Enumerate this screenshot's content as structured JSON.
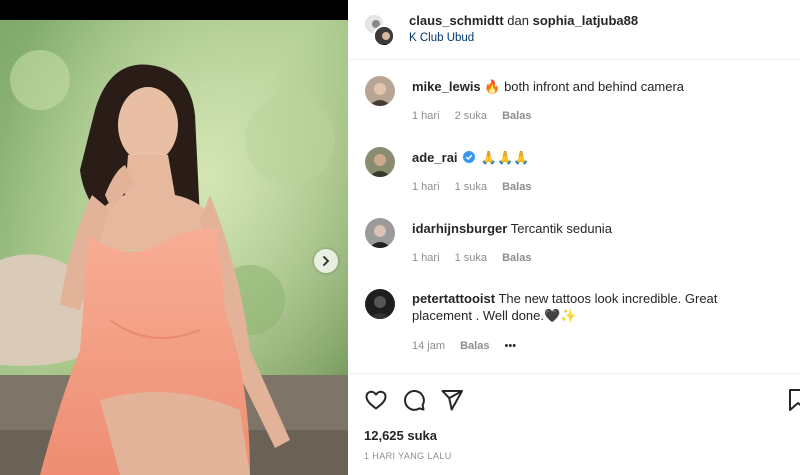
{
  "post": {
    "photo_alt": "woman in coral satin dress",
    "next_icon": "chevron-right-icon"
  },
  "header": {
    "user1": "claus_schmidtt",
    "conjunction": "dan",
    "user2": "sophia_latjuba88",
    "location": "K Club Ubud"
  },
  "comments": [
    {
      "user": "mike_lewis",
      "text": "🔥 both infront and behind camera",
      "time": "1 hari",
      "likes": "2 suka",
      "reply": "Balas"
    },
    {
      "user": "ade_rai",
      "verified": true,
      "text": "🙏🙏🙏",
      "time": "1 hari",
      "likes": "1 suka",
      "reply": "Balas"
    },
    {
      "user": "idarhijnsburger",
      "text": "Tercantik sedunia",
      "time": "1 hari",
      "likes": "1 suka",
      "reply": "Balas"
    },
    {
      "user": "petertattooist",
      "text": "The new tattoos look incredible. Great placement . Well done.🖤✨",
      "time": "14 jam",
      "reply": "Balas",
      "more": "•••"
    }
  ],
  "actions": {
    "like_icon": "heart-icon",
    "comment_icon": "comment-icon",
    "share_icon": "share-icon",
    "save_icon": "bookmark-icon"
  },
  "likes_count": "12,625 suka",
  "posted_time": "1 HARI YANG LALU",
  "colors": {
    "dress": "#f4a088",
    "link": "#00376b",
    "muted": "#8e8e8e",
    "verified": "#3897f0"
  }
}
